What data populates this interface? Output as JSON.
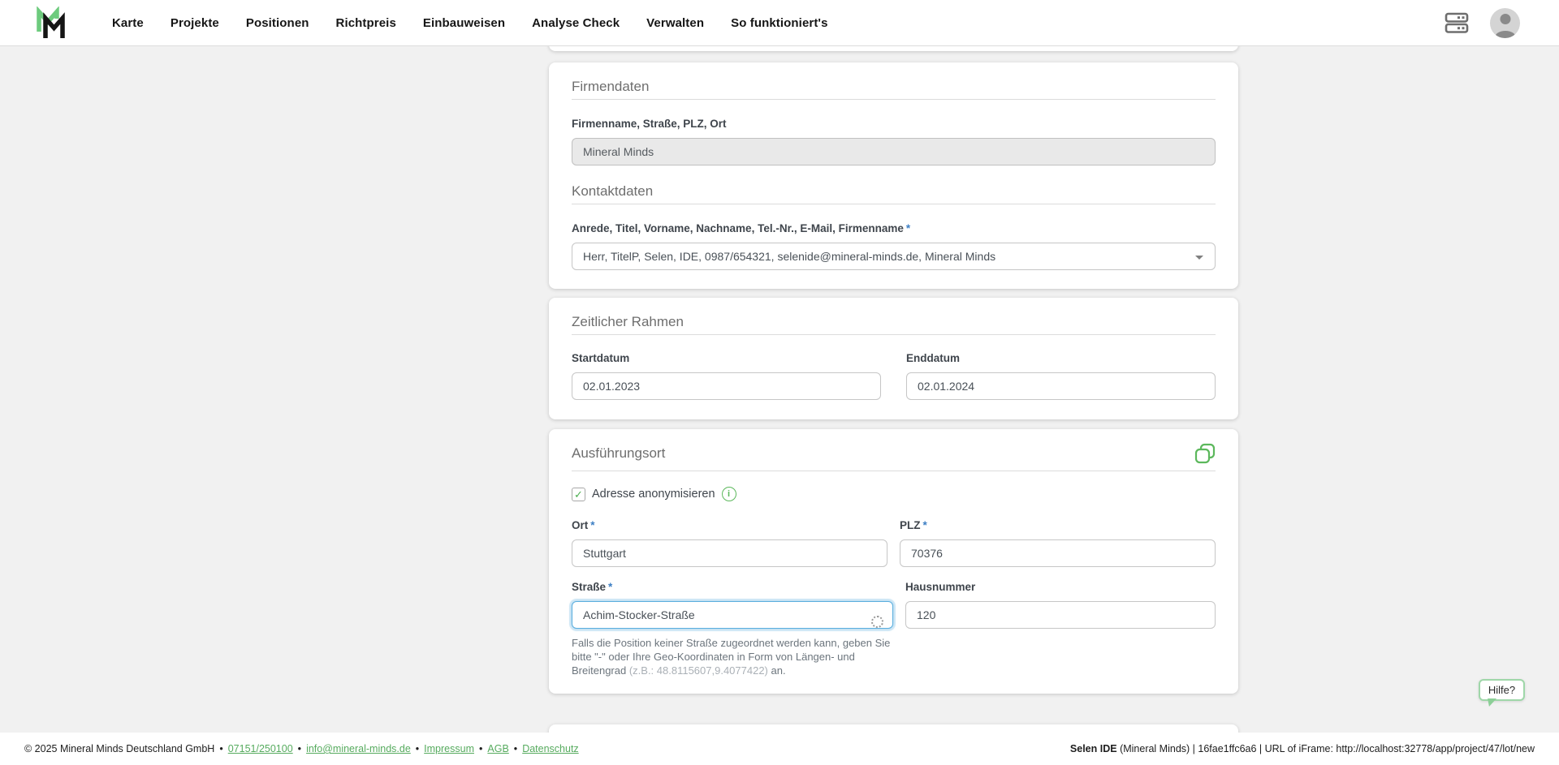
{
  "colors": {
    "brand_green": "#5cb85c",
    "required_blue": "#3d7fc4",
    "focus_blue": "#5aaede",
    "page_background": "#f1f1f1"
  },
  "icons": {
    "check": "✓",
    "info": "i"
  },
  "required_marker": "*",
  "navbar": {
    "items": [
      "Karte",
      "Projekte",
      "Positionen",
      "Richtpreis",
      "Einbauweisen",
      "Analyse Check",
      "Verwalten",
      "So funktioniert's"
    ]
  },
  "company_card": {
    "title": "Firmendaten",
    "company_label": "Firmenname, Straße, PLZ, Ort",
    "company_value": "Mineral Minds",
    "contact_title": "Kontaktdaten",
    "contact_label": "Anrede, Titel, Vorname, Nachname, Tel.-Nr., E-Mail, Firmenname",
    "contact_value": "Herr, TitelP, Selen, IDE, 0987/654321, selenide@mineral-minds.de, Mineral Minds"
  },
  "timeframe_card": {
    "title": "Zeitlicher Rahmen",
    "start_label": "Startdatum",
    "start_value": "02.01.2023",
    "end_label": "Enddatum",
    "end_value": "02.01.2024"
  },
  "location_card": {
    "title": "Ausführungsort",
    "anonymize_label": "Adresse anonymisieren",
    "city_label": "Ort",
    "city_value": "Stuttgart",
    "zip_label": "PLZ",
    "zip_value": "70376",
    "street_label": "Straße",
    "street_value": "Achim-Stocker-Straße",
    "number_label": "Hausnummer",
    "number_value": "120",
    "street_hint_1": "Falls die Position keiner Straße zugeordnet werden kann, geben Sie bitte \"-\" oder Ihre Geo-Koordinaten in Form von Längen- und Breitengrad ",
    "street_hint_example": "(z.B.: 48.8115607,9.4077422)",
    "street_hint_2": " an."
  },
  "help_button": {
    "label": "Hilfe?"
  },
  "footer": {
    "copyright": "© 2025 Mineral Minds Deutschland GmbH",
    "separator": "•",
    "links": [
      "07151/250100",
      "info@mineral-minds.de",
      "Impressum",
      "AGB",
      "Datenschutz"
    ],
    "ide_brand": "Selen IDE",
    "ide_info": "(Mineral Minds) | 16fae1ffc6a6 | URL of iFrame: http://localhost:32778/app/project/47/lot/new"
  }
}
